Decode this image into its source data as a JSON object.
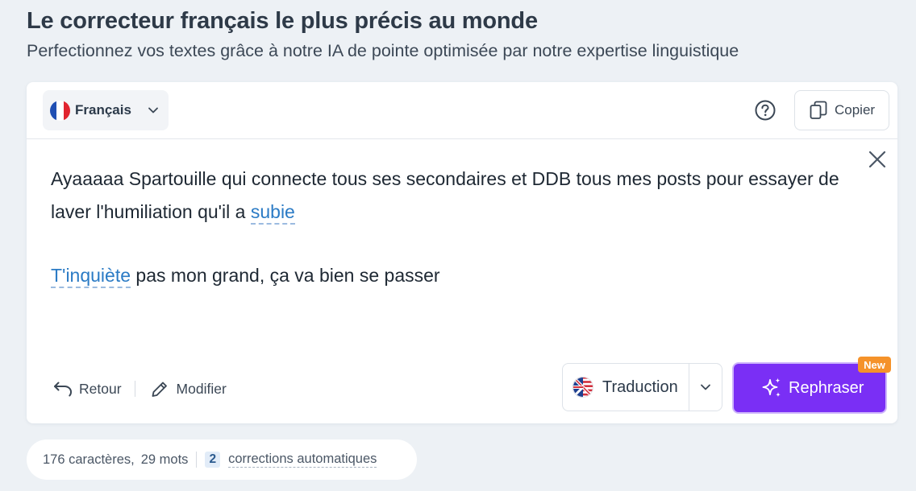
{
  "header": {
    "title": "Le correcteur français le plus précis au monde",
    "subtitle": "Perfectionnez vos textes grâce à notre IA de pointe optimisée par notre expertise linguistique"
  },
  "toolbar": {
    "language": "Français",
    "copy_label": "Copier"
  },
  "editor": {
    "p1_before": "Ayaaaaa Spartouille qui connecte tous ses secondaires et DDB tous mes posts pour essayer de laver l'humiliation qu'il a ",
    "p1_correction": "subie",
    "p2_correction": "T'inquiète",
    "p2_after": " pas mon grand, ça va bien se passer"
  },
  "actions": {
    "back_label": "Retour",
    "edit_label": "Modifier",
    "translate_label": "Traduction",
    "rephrase_label": "Rephraser",
    "new_badge": "New"
  },
  "stats": {
    "characters": "176 caractères,",
    "words": "29 mots",
    "corrections_count": "2",
    "corrections_label": "corrections automatiques"
  },
  "colors": {
    "accent_purple": "#7a2ff5",
    "correction_blue": "#2b7bc5",
    "badge_orange": "#f5922a",
    "background": "#edf1f5"
  },
  "icons": {
    "language_flag": "france-flag-icon",
    "help": "question-circle-icon",
    "copy": "copy-icon",
    "close": "close-icon",
    "back": "undo-arrow-icon",
    "edit": "pencil-icon",
    "translate_flag": "uk-us-flag-icon",
    "rephrase": "sparkles-icon"
  }
}
